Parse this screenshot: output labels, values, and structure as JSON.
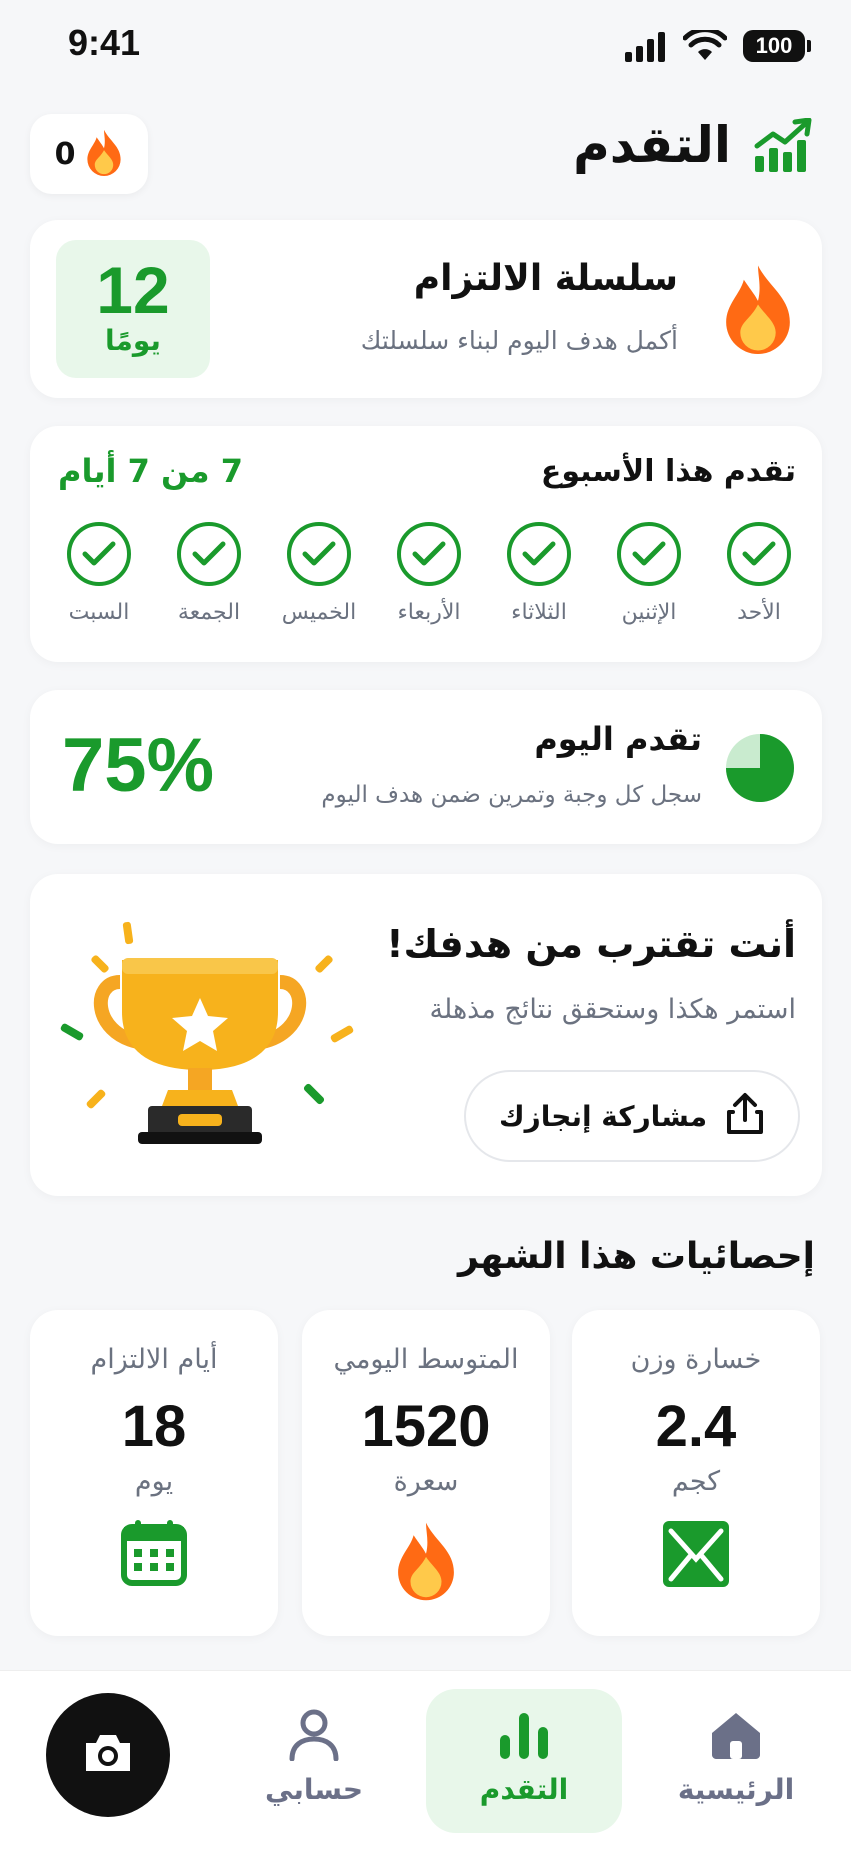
{
  "status_bar": {
    "time": "9:41",
    "battery": "100"
  },
  "header": {
    "title": "التقدم",
    "streak_count": "0"
  },
  "streak_card": {
    "title": "سلسلة الالتزام",
    "subtitle": "أكمل هدف اليوم لبناء سلسلتك",
    "days_value": "12",
    "days_unit": "يومًا"
  },
  "week_card": {
    "title": "تقدم هذا الأسبوع",
    "summary": "7 من 7 أيام",
    "days": [
      {
        "label": "الأحد",
        "done": true
      },
      {
        "label": "الإثنين",
        "done": true
      },
      {
        "label": "الثلاثاء",
        "done": true
      },
      {
        "label": "الأربعاء",
        "done": true
      },
      {
        "label": "الخميس",
        "done": true
      },
      {
        "label": "الجمعة",
        "done": true
      },
      {
        "label": "السبت",
        "done": true
      }
    ]
  },
  "today_card": {
    "title": "تقدم اليوم",
    "subtitle": "سجل كل وجبة وتمرين ضمن هدف اليوم",
    "percent_label": "75%",
    "progress": 0.75
  },
  "goal_card": {
    "title": "أنت تقترب من هدفك!",
    "subtitle": "استمر هكذا وستحقق نتائج مذهلة",
    "share_label": "مشاركة إنجازك"
  },
  "monthly": {
    "title": "إحصائيات هذا الشهر",
    "stats": [
      {
        "title": "خسارة وزن",
        "value": "2.4",
        "unit": "كجم",
        "icon": "scale-icon"
      },
      {
        "title": "المتوسط اليومي",
        "value": "1520",
        "unit": "سعرة",
        "icon": "flame-icon"
      },
      {
        "title": "أيام الالتزام",
        "value": "18",
        "unit": "يوم",
        "icon": "calendar-icon"
      }
    ]
  },
  "nav": {
    "items": [
      {
        "label": "الرئيسية",
        "icon": "home-icon"
      },
      {
        "label": "التقدم",
        "icon": "bar-chart-icon",
        "active": true
      },
      {
        "label": "حسابي",
        "icon": "user-icon"
      }
    ],
    "camera": "camera-icon"
  },
  "colors": {
    "accent": "#1a9a2c",
    "accent_light": "#e8f7ea",
    "flame": "#ff7a1a",
    "trophy": "#f7b21c"
  }
}
